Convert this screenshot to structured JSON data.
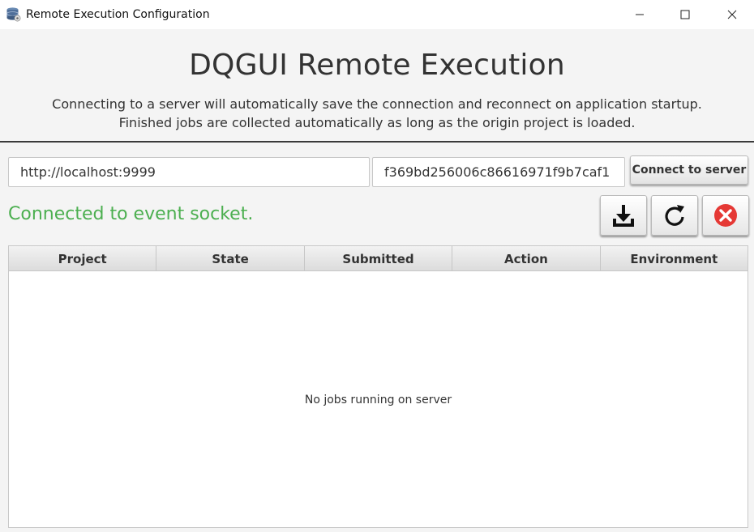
{
  "window": {
    "title": "Remote Execution Configuration",
    "controls": [
      "minimize",
      "maximize",
      "close"
    ]
  },
  "header": {
    "title": "DQGUI Remote Execution",
    "subtitle_line1": "Connecting to a server will automatically save the connection and reconnect on application startup.",
    "subtitle_line2": "Finished jobs are collected automatically as long as the origin project is loaded."
  },
  "connection": {
    "server_url": "http://localhost:9999",
    "access_key": "f369bd256006c86616971f9b7caf1",
    "connect_button": "Connect to server",
    "status": "Connected to event socket.",
    "status_color": "#4caf50"
  },
  "toolbar": {
    "buttons": [
      "download-icon",
      "refresh-icon",
      "disconnect-icon"
    ],
    "disconnect_color": "#e53935"
  },
  "jobs_table": {
    "columns": [
      "Project",
      "State",
      "Submitted",
      "Action",
      "Environment"
    ],
    "rows": [],
    "empty_message": "No jobs running on server"
  }
}
